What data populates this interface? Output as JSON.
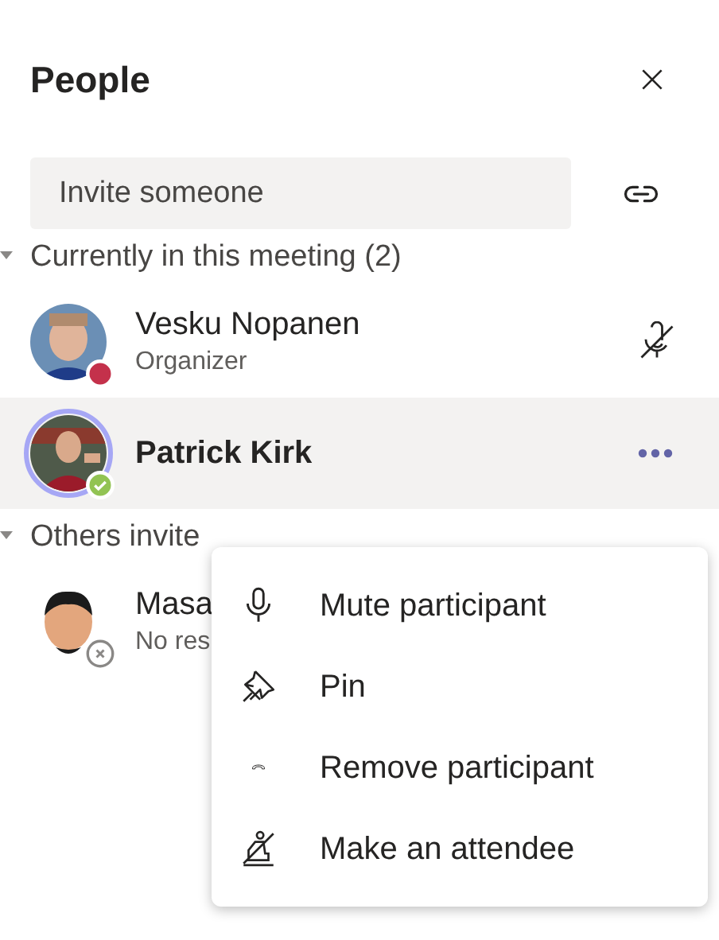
{
  "panel": {
    "title": "People"
  },
  "invite": {
    "placeholder": "Invite someone"
  },
  "sections": [
    {
      "title": "Currently in this meeting (2)",
      "expanded": true,
      "people": [
        {
          "name": "Vesku Nopanen",
          "role": "Organizer",
          "presence": {
            "kind": "busy",
            "color": "#c4314b"
          },
          "muted": true,
          "speaking": false,
          "selected": false
        },
        {
          "name": "Patrick Kirk",
          "presence": {
            "kind": "available",
            "color": "#92c353"
          },
          "muted": false,
          "speaking": true,
          "selected": true
        }
      ]
    },
    {
      "title": "Others invite",
      "expanded": true,
      "people": [
        {
          "name": "Masa",
          "role": "No res",
          "presence": {
            "kind": "offline",
            "color": "#8a8886"
          },
          "muted": false,
          "speaking": false,
          "selected": false
        }
      ]
    }
  ],
  "menu": [
    {
      "kind": "mic",
      "label": "Mute participant"
    },
    {
      "kind": "pin",
      "label": "Pin"
    },
    {
      "kind": "hangup",
      "label": "Remove participant"
    },
    {
      "kind": "attendee",
      "label": "Make an attendee"
    }
  ]
}
